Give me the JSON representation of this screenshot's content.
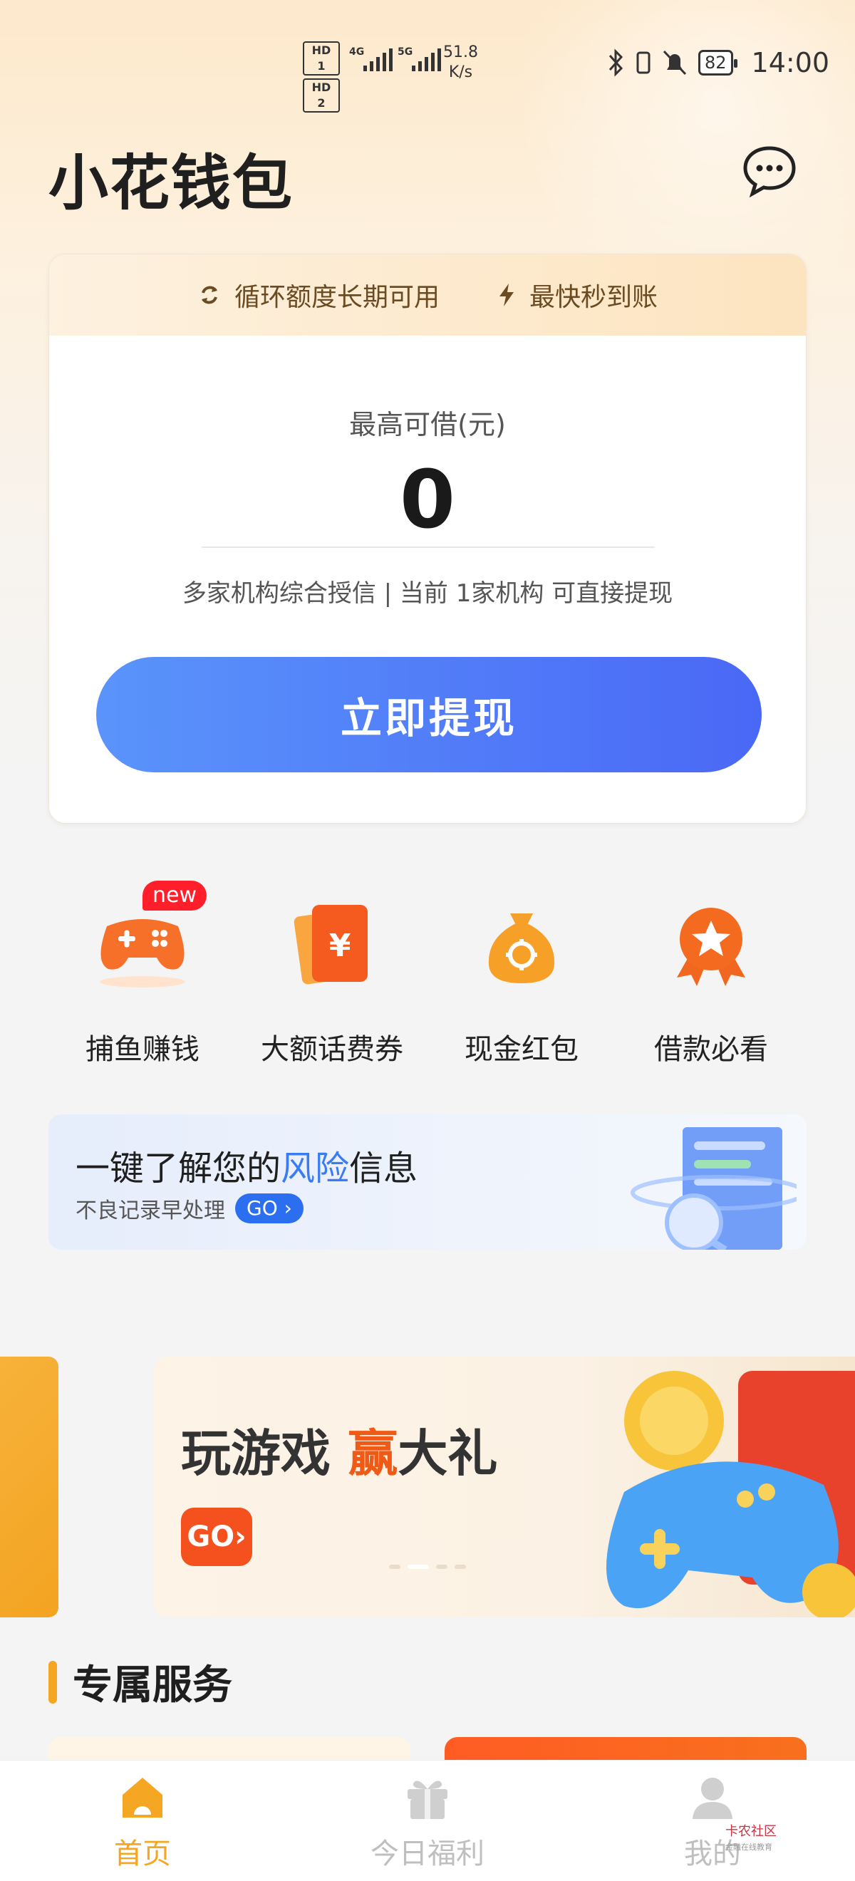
{
  "status_bar": {
    "hd1": "HD 1",
    "hd2": "HD 2",
    "net1": "4G",
    "net2": "5G",
    "speed_value": "51.8",
    "speed_unit": "K/s",
    "battery": "82",
    "time": "14:00"
  },
  "header": {
    "title": "小花钱包",
    "message_icon": "chat-bubble-icon"
  },
  "card": {
    "features": [
      {
        "icon": "refresh-icon",
        "label": "循环额度长期可用"
      },
      {
        "icon": "lightning-icon",
        "label": "最快秒到账"
      }
    ],
    "limit_label": "最高可借(元)",
    "limit_value": "0",
    "description": "多家机构综合授信 | 当前 1家机构 可直接提现",
    "cta_label": "立即提现",
    "cta_colors": [
      "#5a94fb",
      "#4a68f6"
    ]
  },
  "quick_actions": [
    {
      "label": "捕鱼赚钱",
      "icon": "gamepad-icon",
      "badge": "new"
    },
    {
      "label": "大额话费券",
      "icon": "red-envelope-icon"
    },
    {
      "label": "现金红包",
      "icon": "money-bag-icon"
    },
    {
      "label": "借款必看",
      "icon": "star-medal-icon"
    }
  ],
  "risk_banner": {
    "title_prefix": "一键了解您的",
    "title_highlight": "风险",
    "title_suffix": "信息",
    "subtitle": "不良记录早处理",
    "go": "GO"
  },
  "promo": {
    "title_prefix": "玩游戏 ",
    "title_highlight": "赢",
    "title_suffix": "大礼",
    "go": "GO"
  },
  "services": {
    "title": "专属服务"
  },
  "bottom_nav": [
    {
      "label": "首页",
      "icon": "home-icon",
      "active": true
    },
    {
      "label": "今日福利",
      "icon": "gift-icon",
      "active": false
    },
    {
      "label": "我的",
      "icon": "profile-icon",
      "active": false
    }
  ],
  "watermark": {
    "text": "卡农社区",
    "sub": "金融在线教育"
  },
  "colors": {
    "accent": "#f5a623",
    "primary_blue": "#4a68f6",
    "highlight_red": "#f05a17"
  }
}
